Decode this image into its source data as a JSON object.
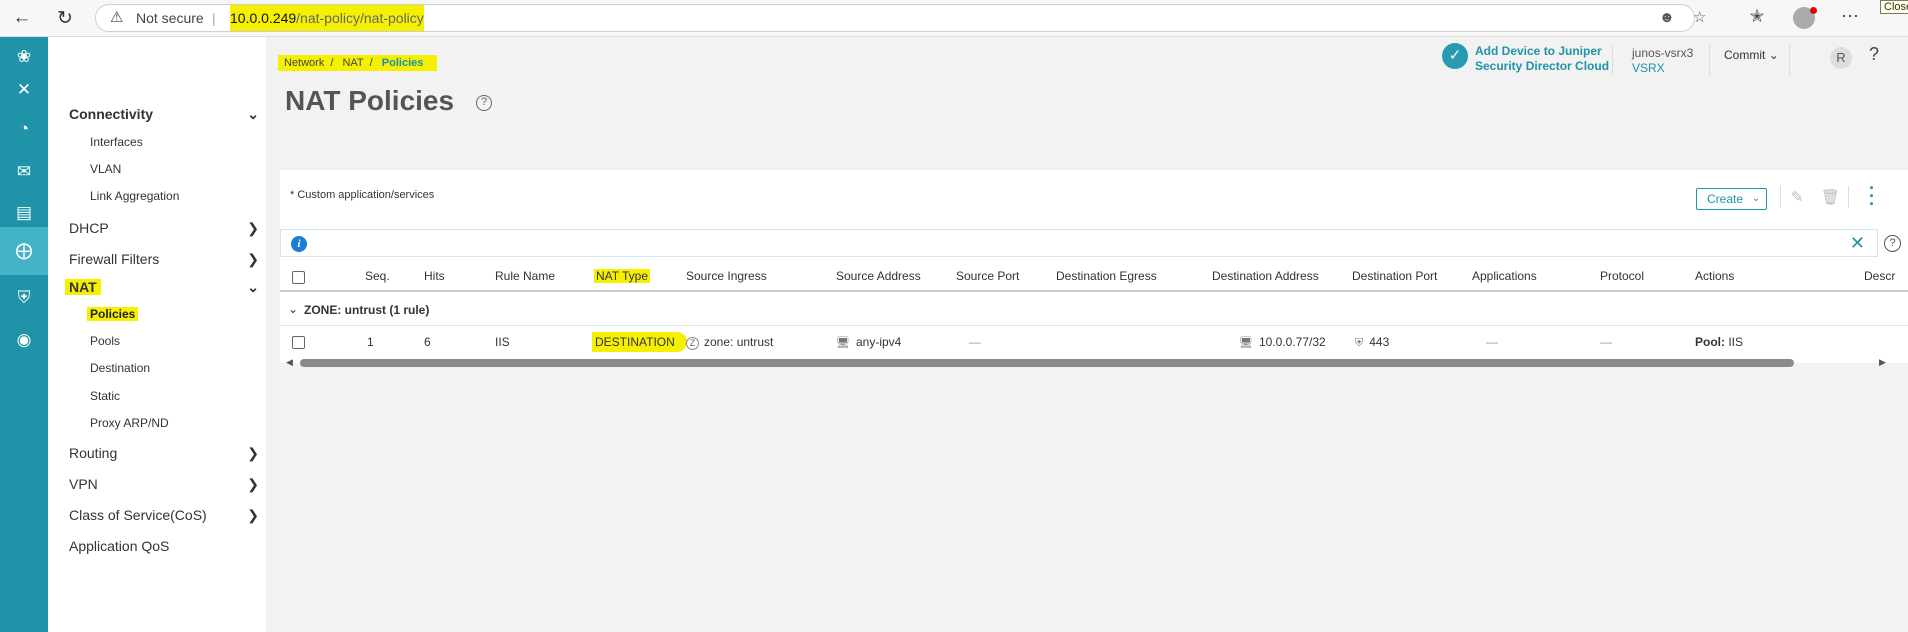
{
  "browser": {
    "security_label": "Not secure",
    "url_host": "10.0.0.249",
    "url_path": "/nat-policy/nat-policy",
    "close_tooltip": "Close"
  },
  "header": {
    "sd_line1": "Add Device to Juniper",
    "sd_line2": "Security Director Cloud",
    "device_name": "junos-vsrx3",
    "device_model": "VSRX",
    "commit_label": "Commit",
    "avatar_initial": "R",
    "help": "?"
  },
  "breadcrumb": [
    "Network",
    "NAT",
    "Policies"
  ],
  "page_title": "NAT Policies",
  "sidebar": {
    "groups": [
      {
        "label": "Connectivity",
        "expanded": true,
        "items": [
          "Interfaces",
          "VLAN",
          "Link Aggregation"
        ]
      },
      {
        "label": "DHCP",
        "expanded": false
      },
      {
        "label": "Firewall Filters",
        "expanded": false
      },
      {
        "label": "NAT",
        "expanded": true,
        "items": [
          "Policies",
          "Pools",
          "Destination",
          "Static",
          "Proxy ARP/ND"
        ],
        "active_item": "Policies"
      },
      {
        "label": "Routing",
        "expanded": false
      },
      {
        "label": "VPN",
        "expanded": false
      },
      {
        "label": "Class of Service(CoS)",
        "expanded": false
      },
      {
        "label": "Application QoS",
        "expanded": false
      }
    ]
  },
  "panel": {
    "custom_note": "* Custom application/services",
    "create_label": "Create"
  },
  "table": {
    "columns": [
      "Seq.",
      "Hits",
      "Rule Name",
      "NAT Type",
      "Source Ingress",
      "Source Address",
      "Source Port",
      "Destination Egress",
      "Destination Address",
      "Destination Port",
      "Applications",
      "Protocol",
      "Actions",
      "Descr"
    ],
    "group_label": "ZONE: untrust (1 rule)",
    "rows": [
      {
        "seq": "1",
        "hits": "6",
        "rule_name": "IIS",
        "nat_type": "DESTINATION",
        "source_ingress": "zone: untrust",
        "source_address": "any-ipv4",
        "source_port": "—",
        "destination_egress": "",
        "destination_address": "10.0.0.77/32",
        "destination_port": "443",
        "applications": "—",
        "protocol": "—",
        "actions_key": "Pool:",
        "actions_value": " IIS"
      }
    ]
  }
}
